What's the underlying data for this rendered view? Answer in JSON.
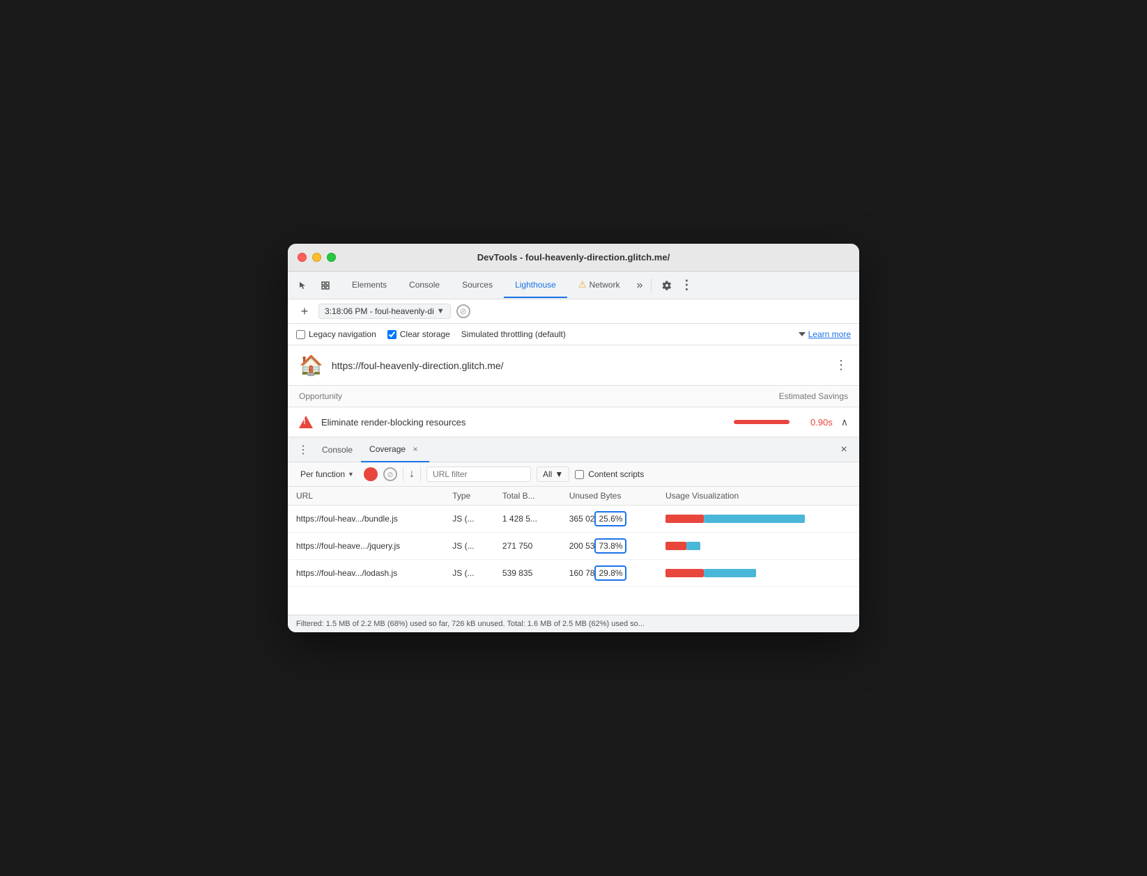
{
  "window": {
    "title": "DevTools - foul-heavenly-direction.glitch.me/"
  },
  "tabs": {
    "items": [
      {
        "label": "Elements",
        "active": false
      },
      {
        "label": "Console",
        "active": false
      },
      {
        "label": "Sources",
        "active": false
      },
      {
        "label": "Lighthouse",
        "active": true
      },
      {
        "label": "Network",
        "active": false
      }
    ],
    "more_label": "»"
  },
  "address_bar": {
    "add_label": "+",
    "url_text": "3:18:06 PM - foul-heavenly-di",
    "dropdown_label": "▼"
  },
  "options": {
    "legacy_nav_label": "Legacy navigation",
    "clear_storage_label": "Clear storage",
    "throttling_label": "Simulated throttling (default)",
    "learn_more_label": "Learn more"
  },
  "lighthouse_section": {
    "logo": "🏠",
    "url": "https://foul-heavenly-direction.glitch.me/",
    "more_icon": "⋮"
  },
  "opportunity": {
    "header_left": "Opportunity",
    "header_right": "Estimated Savings",
    "item_text": "Eliminate render-blocking resources",
    "savings_time": "0.90s",
    "expand_label": "∧"
  },
  "coverage_panel": {
    "three_dots": "⋮",
    "console_tab": "Console",
    "coverage_tab": "Coverage",
    "close_tab_label": "×",
    "close_panel_label": "×",
    "per_function_label": "Per function",
    "all_label": "All",
    "url_filter_placeholder": "URL filter",
    "content_scripts_label": "Content scripts"
  },
  "table": {
    "headers": [
      "URL",
      "Type",
      "Total B...",
      "Unused Bytes",
      "Usage Visualization"
    ],
    "rows": [
      {
        "url": "https://foul-heav.../bundle.js",
        "type": "JS (...",
        "total": "1 428 5...",
        "unused_raw": "365 02",
        "unused_pct": "25.6%",
        "used_width": 55,
        "unused_width": 145,
        "highlight": true
      },
      {
        "url": "https://foul-heave.../jquery.js",
        "type": "JS (...",
        "total": "271 750",
        "unused_raw": "200 53",
        "unused_pct": "73.8%",
        "used_width": 30,
        "unused_width": 20,
        "highlight": true
      },
      {
        "url": "https://foul-heav.../lodash.js",
        "type": "JS (...",
        "total": "539 835",
        "unused_raw": "160 78",
        "unused_pct": "29.8%",
        "used_width": 55,
        "unused_width": 75,
        "highlight": true
      }
    ]
  },
  "status_bar": {
    "text": "Filtered: 1.5 MB of 2.2 MB (68%) used so far, 726 kB unused. Total: 1.6 MB of 2.5 MB (62%) used so..."
  }
}
